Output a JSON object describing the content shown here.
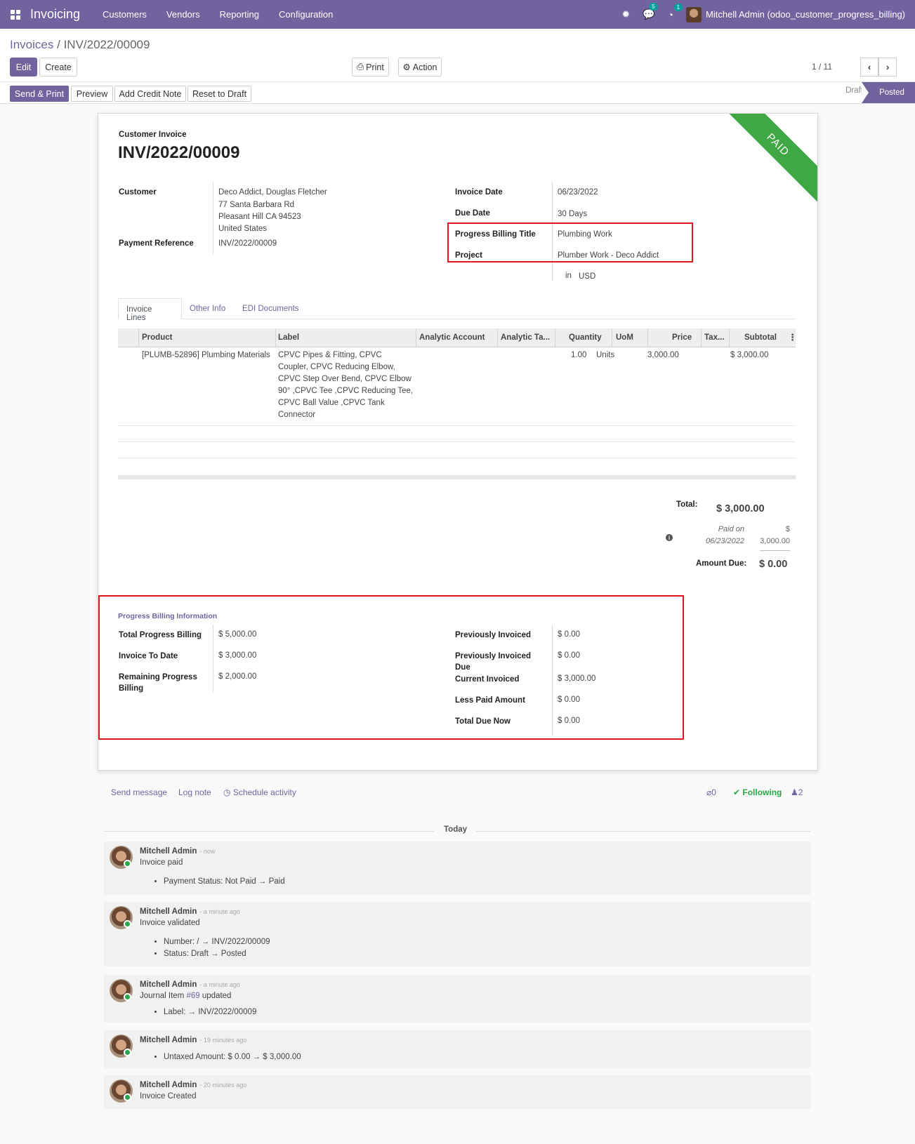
{
  "app": {
    "name": "Invoicing",
    "menu": [
      "Customers",
      "Vendors",
      "Reporting",
      "Configuration"
    ]
  },
  "systray": {
    "messages_count": "5",
    "activities_count": "1",
    "user": "Mitchell Admin (odoo_customer_progress_billing)"
  },
  "breadcrumb": {
    "parent": "Invoices",
    "sep": "/",
    "current": "INV/2022/00009"
  },
  "buttons": {
    "edit": "Edit",
    "create": "Create",
    "print": "Print",
    "action": "Action",
    "send_print": "Send & Print",
    "preview": "Preview",
    "add_credit_note": "Add Credit Note",
    "reset_to_draft": "Reset to Draft"
  },
  "pager": {
    "value": "1 / 11"
  },
  "status": {
    "draft": "Draft",
    "posted": "Posted"
  },
  "invoice": {
    "ribbon": "PAID",
    "type": "Customer Invoice",
    "name": "INV/2022/00009",
    "customer_label": "Customer",
    "customer": "Deco Addict, Douglas Fletcher",
    "address": [
      "77 Santa Barbara Rd",
      "Pleasant Hill CA 94523",
      "United States"
    ],
    "payment_ref_label": "Payment Reference",
    "payment_ref": "INV/2022/00009",
    "invoice_date_label": "Invoice Date",
    "invoice_date": "06/23/2022",
    "due_date_label": "Due Date",
    "due_date": "30 Days",
    "pb_title_label": "Progress Billing Title",
    "pb_title": "Plumbing Work",
    "project_label": "Project",
    "project": "Plumber Work - Deco Addict",
    "currency_prefix": "in",
    "currency": "USD"
  },
  "tabs": [
    "Invoice Lines",
    "Other Info",
    "EDI Documents"
  ],
  "lines": {
    "columns": [
      "Product",
      "Label",
      "Analytic Account",
      "Analytic Ta...",
      "Quantity",
      "UoM",
      "Price",
      "Tax...",
      "Subtotal"
    ],
    "rows": [
      {
        "product": "[PLUMB-52896] Plumbing Materials",
        "label": [
          "CPVC Pipes & Fitting, CPVC",
          "Coupler, CPVC Reducing Elbow,",
          "CPVC Step Over Bend, CPVC Elbow",
          "90° ,CPVC Tee ,CPVC Reducing Tee,",
          "CPVC Ball Value ,CPVC Tank",
          "Connector"
        ],
        "quantity": "1.00",
        "uom": "Units",
        "price": "3,000.00",
        "subtotal": "$ 3,000.00"
      }
    ]
  },
  "totals": {
    "total_label": "Total:",
    "total": "$ 3,000.00",
    "paid_on_line1": "Paid on",
    "paid_on_date": "06/23/2022",
    "paid_amount_line1": "$",
    "paid_amount_line2": "3,000.00",
    "amount_due_label": "Amount Due:",
    "amount_due": "$ 0.00"
  },
  "progress_billing": {
    "title": "Progress Billing Information",
    "total_progress_billing_label": "Total Progress Billing",
    "total_progress_billing": "$ 5,000.00",
    "invoice_to_date_label": "Invoice To Date",
    "invoice_to_date": "$ 3,000.00",
    "remaining_label_1": "Remaining Progress",
    "remaining_label_2": "Billing",
    "remaining": "$ 2,000.00",
    "previously_invoiced_label": "Previously Invoiced",
    "previously_invoiced": "$ 0.00",
    "previously_invoiced_due_label_1": "Previously Invoiced",
    "previously_invoiced_due_label_2": "Due",
    "previously_invoiced_due": "$ 0.00",
    "current_invoiced_label": "Current Invoiced",
    "current_invoiced": "$ 3,000.00",
    "less_paid_label": "Less Paid Amount",
    "less_paid": "$ 0.00",
    "total_due_now_label": "Total Due Now",
    "total_due_now": "$ 0.00"
  },
  "chatter": {
    "send_message": "Send message",
    "log_note": "Log note",
    "schedule_activity": "Schedule activity",
    "attachments": "0",
    "following": "Following",
    "followers": "2",
    "day": "Today",
    "messages": [
      {
        "author": "Mitchell Admin",
        "when": "- now",
        "body": "Invoice paid",
        "items": [
          "Payment Status: Not Paid → Paid"
        ]
      },
      {
        "author": "Mitchell Admin",
        "when": "- a minute ago",
        "body": "Invoice validated",
        "items": [
          "Number: / → INV/2022/00009",
          "Status: Draft → Posted"
        ]
      },
      {
        "author": "Mitchell Admin",
        "when": "- a minute ago",
        "body_pre": "Journal Item",
        "body_link": "#69",
        "body_post": "updated",
        "items": [
          "Label: → INV/2022/00009"
        ]
      },
      {
        "author": "Mitchell Admin",
        "when": "- 19 minutes ago",
        "items": [
          "Untaxed Amount: $ 0.00 → $ 3,000.00"
        ]
      },
      {
        "author": "Mitchell Admin",
        "when": "- 20 minutes ago",
        "body": "Invoice Created"
      }
    ]
  }
}
